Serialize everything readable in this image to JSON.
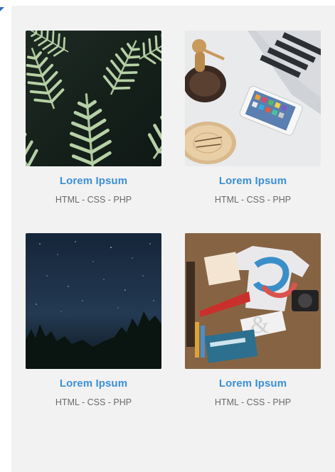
{
  "portfolio": {
    "items": [
      {
        "title": "Lorem Ipsum",
        "tags": "HTML - CSS - PHP",
        "image": "fern-leaves"
      },
      {
        "title": "Lorem Ipsum",
        "tags": "HTML - CSS - PHP",
        "image": "desk-laptop-phone"
      },
      {
        "title": "Lorem Ipsum",
        "tags": "HTML - CSS - PHP",
        "image": "night-sky-trees"
      },
      {
        "title": "Lorem Ipsum",
        "tags": "HTML - CSS - PHP",
        "image": "designer-workspace"
      }
    ]
  },
  "colors": {
    "accent": "#3b8fd8",
    "panel": "#f2f2f2",
    "meta_text": "#6a6a6a"
  }
}
